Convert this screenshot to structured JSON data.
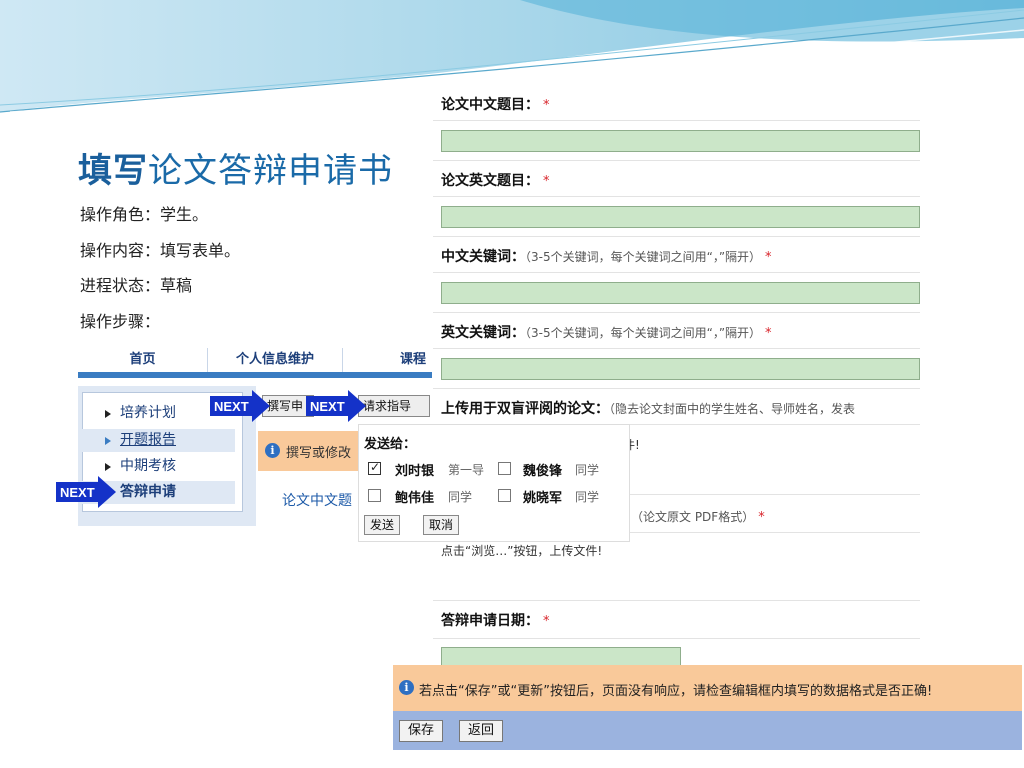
{
  "slide": {
    "title_bold": "填写",
    "title_rest": "论文答辩申请书",
    "role": "操作角色：学生。",
    "content": "操作内容：填写表单。",
    "status": "进程状态：草稿",
    "steps": "操作步骤："
  },
  "nav": {
    "tabs": [
      "首页",
      "个人信息维护",
      "课程"
    ],
    "sidebar": [
      "培养计划",
      "开题报告",
      "中期考核",
      "答辩申请"
    ],
    "write_button": "撰写申",
    "request_button": "请求指导",
    "warning": "撰写或修改",
    "form_link": "论文中文题",
    "next_label": "NEXT"
  },
  "popup": {
    "title": "发送给：",
    "recipients": [
      {
        "name": "刘时银",
        "role": "第一导",
        "checked": true
      },
      {
        "name": "魏俊锋",
        "role": "同学",
        "checked": false
      },
      {
        "name": "鲍伟佳",
        "role": "同学",
        "checked": false
      },
      {
        "name": "姚晓军",
        "role": "同学",
        "checked": false
      }
    ],
    "send": "发送",
    "cancel": "取消"
  },
  "form": {
    "cn_title_label": "论文中文题目：",
    "en_title_label": "论文英文题目：",
    "cn_keywords_label": "中文关键词：",
    "en_keywords_label": "英文关键词：",
    "keywords_hint": "（3-5个关键词，每个关键词之间用“，”隔开）",
    "upload_blind_label": "上传用于双盲评阅的论文：",
    "upload_blind_hint": "（隐去论文封面中的学生姓名、导师姓名，发表",
    "upload_blind_note": "件!",
    "upload_original_prefix": "：",
    "upload_original_hint": "（论文原文 PDF格式）",
    "upload_note": "点击“浏览…”按钮，上传文件!",
    "defense_date_label": "答辩申请日期：",
    "required_mark": "*"
  },
  "footer": {
    "warning": "若点击“保存”或“更新”按钮后，页面没有响应，请检查编辑框内填写的数据格式是否正确!",
    "save": "保存",
    "back": "返回"
  },
  "colors": {
    "accent": "#1a6aa8",
    "input_green": "#cbe6c8",
    "warning_orange": "#f9c99a",
    "button_bar": "#9bb3df",
    "next_blue": "#1432c8",
    "required_red": "#d8232a"
  }
}
